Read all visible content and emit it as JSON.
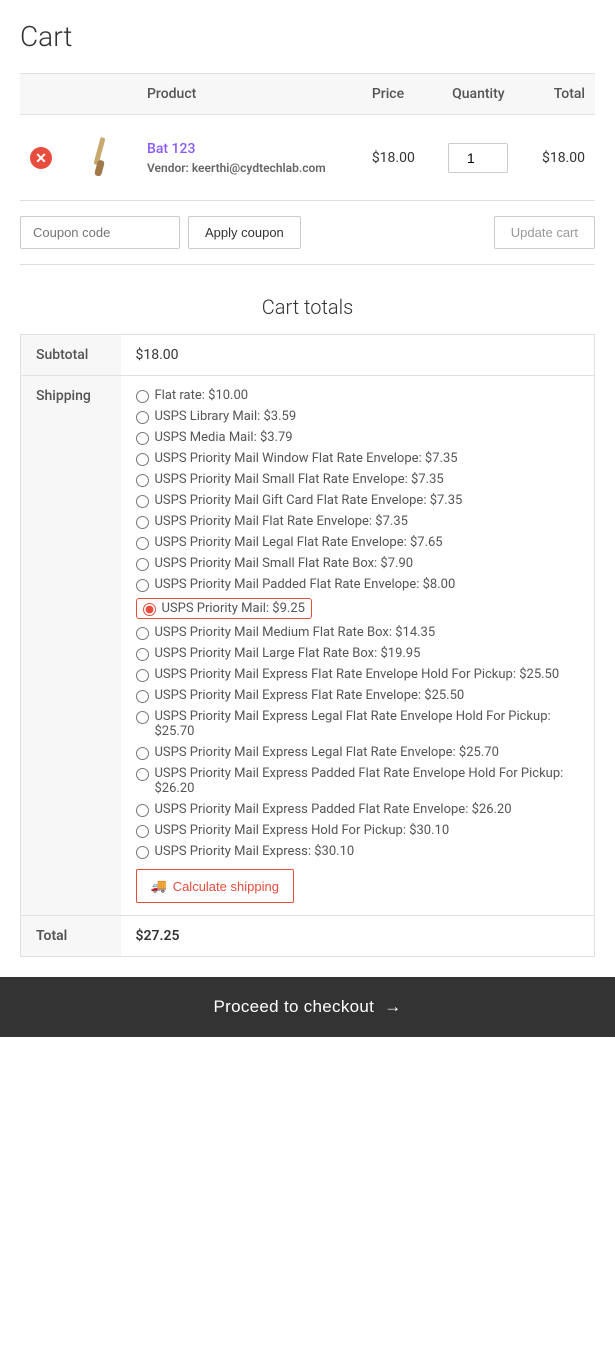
{
  "page": {
    "title": "Cart"
  },
  "table": {
    "headers": {
      "product": "Product",
      "price": "Price",
      "quantity": "Quantity",
      "total": "Total"
    }
  },
  "cart_item": {
    "product_name": "Bat 123",
    "product_color": "#8b5cf6",
    "vendor_label": "Vendor:",
    "vendor_email": "keerthi@cydtechlab.com",
    "price": "$18.00",
    "quantity": "1",
    "total": "$18.00"
  },
  "coupon": {
    "placeholder": "Coupon code",
    "apply_label": "Apply coupon",
    "update_label": "Update cart"
  },
  "cart_totals": {
    "title": "Cart totals",
    "subtotal_label": "Subtotal",
    "subtotal_value": "$18.00",
    "shipping_label": "Shipping",
    "total_label": "Total",
    "total_value": "$27.25"
  },
  "shipping_options": [
    {
      "id": "flat_rate",
      "label": "Flat rate: $10.00",
      "selected": false
    },
    {
      "id": "usps_library",
      "label": "USPS Library Mail: $3.59",
      "selected": false
    },
    {
      "id": "usps_media",
      "label": "USPS Media Mail: $3.79",
      "selected": false
    },
    {
      "id": "usps_priority_window",
      "label": "USPS Priority Mail Window Flat Rate Envelope: $7.35",
      "selected": false
    },
    {
      "id": "usps_priority_small_envelope",
      "label": "USPS Priority Mail Small Flat Rate Envelope: $7.35",
      "selected": false
    },
    {
      "id": "usps_priority_gift",
      "label": "USPS Priority Mail Gift Card Flat Rate Envelope: $7.35",
      "selected": false
    },
    {
      "id": "usps_priority_flat",
      "label": "USPS Priority Mail Flat Rate Envelope: $7.35",
      "selected": false
    },
    {
      "id": "usps_priority_legal",
      "label": "USPS Priority Mail Legal Flat Rate Envelope: $7.65",
      "selected": false
    },
    {
      "id": "usps_priority_small_box",
      "label": "USPS Priority Mail Small Flat Rate Box: $7.90",
      "selected": false
    },
    {
      "id": "usps_priority_padded",
      "label": "USPS Priority Mail Padded Flat Rate Envelope: $8.00",
      "selected": false
    },
    {
      "id": "usps_priority",
      "label": "USPS Priority Mail: $9.25",
      "selected": true
    },
    {
      "id": "usps_priority_medium",
      "label": "USPS Priority Mail Medium Flat Rate Box: $14.35",
      "selected": false
    },
    {
      "id": "usps_priority_large",
      "label": "USPS Priority Mail Large Flat Rate Box: $19.95",
      "selected": false
    },
    {
      "id": "usps_express_window",
      "label": "USPS Priority Mail Express Flat Rate Envelope Hold For Pickup: $25.50",
      "selected": false
    },
    {
      "id": "usps_express_flat",
      "label": "USPS Priority Mail Express Flat Rate Envelope: $25.50",
      "selected": false
    },
    {
      "id": "usps_express_legal_hold",
      "label": "USPS Priority Mail Express Legal Flat Rate Envelope Hold For Pickup: $25.70",
      "selected": false
    },
    {
      "id": "usps_express_legal",
      "label": "USPS Priority Mail Express Legal Flat Rate Envelope: $25.70",
      "selected": false
    },
    {
      "id": "usps_express_padded_hold",
      "label": "USPS Priority Mail Express Padded Flat Rate Envelope Hold For Pickup: $26.20",
      "selected": false
    },
    {
      "id": "usps_express_padded",
      "label": "USPS Priority Mail Express Padded Flat Rate Envelope: $26.20",
      "selected": false
    },
    {
      "id": "usps_express_hold",
      "label": "USPS Priority Mail Express Hold For Pickup: $30.10",
      "selected": false
    },
    {
      "id": "usps_express",
      "label": "USPS Priority Mail Express: $30.10",
      "selected": false
    }
  ],
  "calculate_shipping": {
    "label": "Calculate shipping",
    "icon": "🚚"
  },
  "checkout": {
    "label": "Proceed to checkout",
    "arrow": "→"
  }
}
